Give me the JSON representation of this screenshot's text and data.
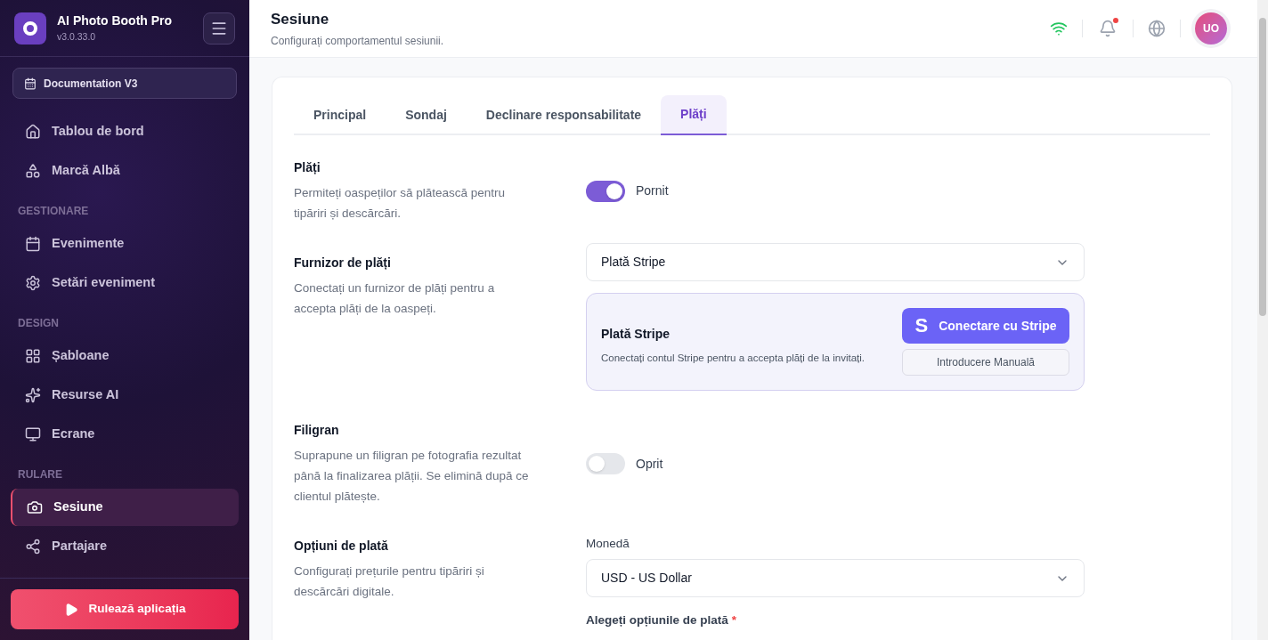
{
  "app": {
    "name": "AI Photo Booth Pro",
    "version": "v3.0.33.0"
  },
  "event_selector": {
    "label": "Documentation V3"
  },
  "sidebar": {
    "groups": [
      {
        "items": [
          {
            "label": "Tablou de bord",
            "selected": false
          },
          {
            "label": "Marcă Albă",
            "selected": false
          }
        ]
      },
      {
        "heading": "GESTIONARE",
        "items": [
          {
            "label": "Evenimente",
            "selected": false
          },
          {
            "label": "Setări eveniment",
            "selected": false
          }
        ]
      },
      {
        "heading": "DESIGN",
        "items": [
          {
            "label": "Șabloane",
            "selected": false
          },
          {
            "label": "Resurse AI",
            "selected": false
          },
          {
            "label": "Ecrane",
            "selected": false
          }
        ]
      },
      {
        "heading": "RULARE",
        "items": [
          {
            "label": "Sesiune",
            "selected": true
          },
          {
            "label": "Partajare",
            "selected": false
          }
        ]
      }
    ]
  },
  "run_button": {
    "label": "Rulează aplicația"
  },
  "header": {
    "title": "Sesiune",
    "subtitle": "Configurați comportamentul sesiunii.",
    "notification_dot": true,
    "avatar": "UO"
  },
  "tabs": [
    {
      "label": "Principal",
      "selected": false
    },
    {
      "label": "Sondaj",
      "selected": false
    },
    {
      "label": "Declinare responsabilitate",
      "selected": false
    },
    {
      "label": "Plăți",
      "selected": true
    }
  ],
  "settings": [
    {
      "kind": "toggle",
      "title": "Plăți",
      "description": "Permiteți oaspeților să plătească pentru tipăriri și descărcări.",
      "on": true,
      "state_label": "Pornit"
    },
    {
      "kind": "provider",
      "title": "Furnizor de plăți",
      "description": "Conectați un furnizor de plăți pentru a accepta plăți de la oaspeți.",
      "value": "Plată Stripe",
      "panel": {
        "title": "Plată Stripe",
        "text": "Conectați contul Stripe pentru a accepta plăți de la invitați.",
        "connect_icon": "S",
        "connect": "Conectare cu Stripe",
        "manual": "Introducere Manuală"
      }
    },
    {
      "kind": "toggle",
      "title": "Filigran",
      "description": "Suprapune un filigran pe fotografia rezultat până la finalizarea plății. Se elimină după ce clientul plătește.",
      "on": false,
      "state_label": "Oprit"
    },
    {
      "kind": "currency",
      "title": "Opțiuni de plată",
      "description": "Configurați prețurile pentru tipăriri și descărcări digitale.",
      "field_label": "Monedă",
      "value": "USD - US Dollar",
      "next_label": "Alegeți opțiunile de plată",
      "required_mark": "*"
    }
  ]
}
